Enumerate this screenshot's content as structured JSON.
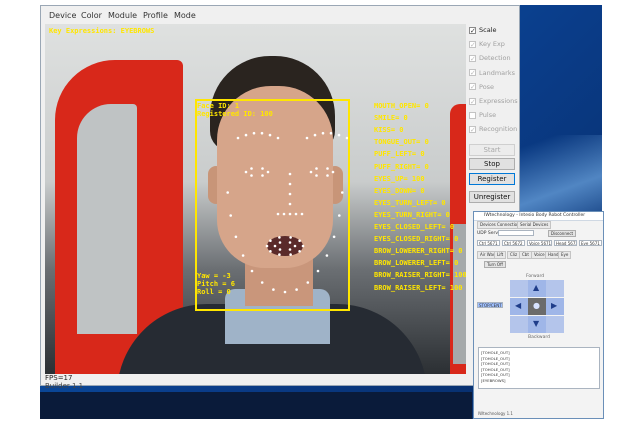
{
  "app": {
    "menu": [
      "Device",
      "Color",
      "Module",
      "Profile",
      "Mode"
    ],
    "fps": "FPS=17",
    "build": "Builder 1.1"
  },
  "overlay": {
    "key_expressions": "Key Expressions: EYEBROWS",
    "face_id": "Face ID: 1",
    "registered_id": "Registered ID: 100",
    "yaw": "Yaw = -3",
    "pitch": "Pitch = 6",
    "roll": "Roll = 0",
    "expressions": [
      "MOUTH_OPEN= 0",
      "SMILE= 0",
      "KISS= 0",
      "TONGUE_OUT= 0",
      "PUFF_LEFT= 0",
      "PUFF_RIGHT= 0",
      "EYES_UP= 100",
      "EYES_DOWN= 0",
      "EYES_TURN_LEFT= 0",
      "EYES_TURN_RIGHT= 0",
      "EYES_CLOSED_LEFT= 0",
      "EYES_CLOSED_RIGHT= 0",
      "BROW_LOWERER_RIGHT= 0",
      "BROW_LOWERER_LEFT= 0",
      "BROW_RAISER_RIGHT= 100",
      "BROW_RAISER_LEFT= 100"
    ],
    "overlay_color": "#ffe600"
  },
  "options": [
    {
      "label": "Scale",
      "checked": true,
      "enabled": true
    },
    {
      "label": "Key Exp",
      "checked": true,
      "enabled": false
    },
    {
      "label": "Detection",
      "checked": true,
      "enabled": false
    },
    {
      "label": "Landmarks",
      "checked": true,
      "enabled": false
    },
    {
      "label": "Pose",
      "checked": true,
      "enabled": false
    },
    {
      "label": "Expressions",
      "checked": true,
      "enabled": false
    },
    {
      "label": "Pulse",
      "checked": false,
      "enabled": false
    },
    {
      "label": "Recognition",
      "checked": true,
      "enabled": false
    }
  ],
  "buttons": {
    "start": "Start",
    "stop": "Stop",
    "register": "Register",
    "unregister": "Unregister"
  },
  "robot_window": {
    "title": "IWtechnology - Intesio Body Robot Controller",
    "tabs": [
      "Devices Connection",
      "Serial Devices"
    ],
    "udp_server_label": "UDP Server",
    "disconnect": "Disconnect",
    "fields": [
      "Ctrl 5671",
      "Ctrl 5672",
      "Voice 5671",
      "Head 5672",
      "Eye 5671"
    ],
    "mode_tabs": [
      "Air Wave",
      "Lift",
      "Cliz",
      "Cbt",
      "Voice",
      "Hand",
      "Eye"
    ],
    "turn_off": "Turn Off",
    "forward": "Forward",
    "backward": "Backward",
    "stop_label": "STOP/CENTER",
    "log": [
      "[TOHOLE_OUT]",
      "[TOHOLE_OUT]",
      "[TOHOLE_OUT]",
      "[TOHOLE_OUT]",
      "[TOHOLE_OUT]",
      "[EYEBROWS]"
    ],
    "version": "IWtechnology 1.1",
    "pad_color": "#9fb6e8"
  }
}
